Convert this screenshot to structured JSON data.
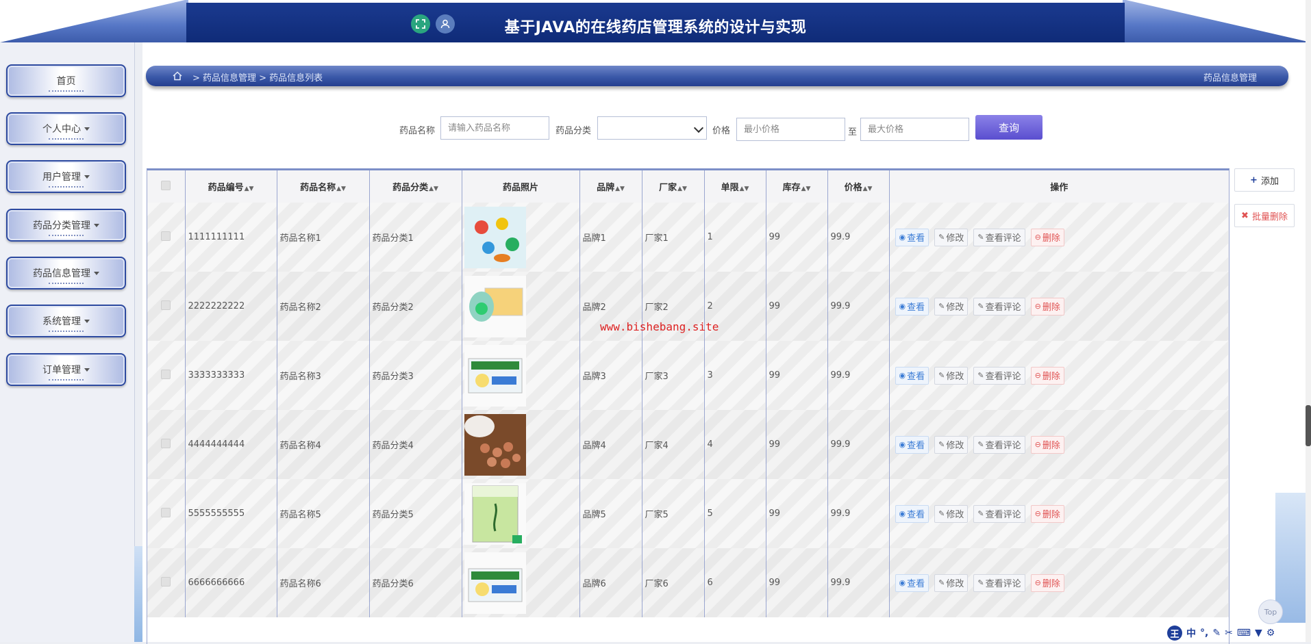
{
  "header": {
    "title": "基于JAVA的在线药店管理系统的设计与实现",
    "accent": "#0f2b78",
    "icons": [
      "fullscreen-icon",
      "user-icon"
    ]
  },
  "sidebar": {
    "items": [
      {
        "label": "首页",
        "has_caret": false
      },
      {
        "label": "个人中心",
        "has_caret": true
      },
      {
        "label": "用户管理",
        "has_caret": true
      },
      {
        "label": "药品分类管理",
        "has_caret": true
      },
      {
        "label": "药品信息管理",
        "has_caret": true
      },
      {
        "label": "系统管理",
        "has_caret": true
      },
      {
        "label": "订单管理",
        "has_caret": true
      }
    ]
  },
  "breadcrumb": {
    "path": "> 药品信息管理 > 药品信息列表",
    "right": "药品信息管理"
  },
  "search": {
    "name_label": "药品名称",
    "name_placeholder": "请输入药品名称",
    "category_label": "药品分类",
    "category_value": "",
    "price_label": "价格",
    "min_placeholder": "最小价格",
    "to": "至",
    "max_placeholder": "最大价格",
    "query_button": "查询"
  },
  "actions": {
    "add": "添加",
    "batch_delete": "批量删除"
  },
  "table": {
    "headers": [
      "药品编号",
      "药品名称",
      "药品分类",
      "药品照片",
      "品牌",
      "厂家",
      "单限",
      "库存",
      "价格",
      "操作"
    ],
    "op_labels": {
      "view": "查看",
      "edit": "修改",
      "review": "查看评论",
      "delete": "删除"
    },
    "rows": [
      {
        "code": "1111111111",
        "name": "药品名称1",
        "category": "药品分类1",
        "brand": "品牌1",
        "maker": "厂家1",
        "limit": "1",
        "stock": "99",
        "price": "99.9"
      },
      {
        "code": "2222222222",
        "name": "药品名称2",
        "category": "药品分类2",
        "brand": "品牌2",
        "maker": "厂家2",
        "limit": "2",
        "stock": "99",
        "price": "99.9"
      },
      {
        "code": "3333333333",
        "name": "药品名称3",
        "category": "药品分类3",
        "brand": "品牌3",
        "maker": "厂家3",
        "limit": "3",
        "stock": "99",
        "price": "99.9"
      },
      {
        "code": "4444444444",
        "name": "药品名称4",
        "category": "药品分类4",
        "brand": "品牌4",
        "maker": "厂家4",
        "limit": "4",
        "stock": "99",
        "price": "99.9"
      },
      {
        "code": "5555555555",
        "name": "药品名称5",
        "category": "药品分类5",
        "brand": "品牌5",
        "maker": "厂家5",
        "limit": "5",
        "stock": "99",
        "price": "99.9"
      },
      {
        "code": "6666666666",
        "name": "药品名称6",
        "category": "药品分类6",
        "brand": "品牌6",
        "maker": "厂家6",
        "limit": "6",
        "stock": "99",
        "price": "99.9"
      }
    ]
  },
  "watermark": "www.bishebang.site",
  "top_button": "Top",
  "ime": {
    "wang": "王",
    "zh": "中"
  }
}
